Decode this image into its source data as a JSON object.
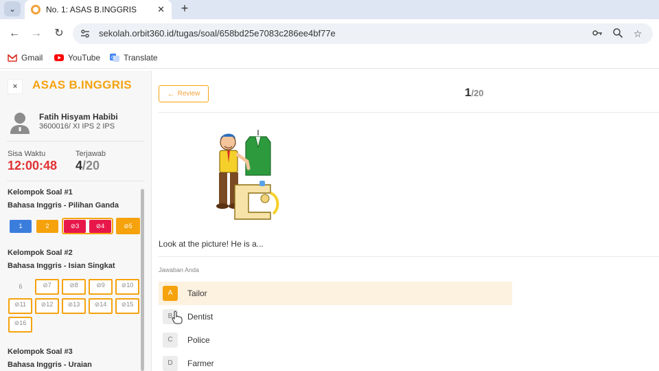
{
  "browser": {
    "tab_title": "No. 1: ASAS B.INGGRIS",
    "new_tab": "+",
    "url": "sekolah.orbit360.id/tugas/soal/658bd25e7083c286ee4bf77e",
    "bookmarks": [
      "Gmail",
      "YouTube",
      "Translate"
    ]
  },
  "sidebar": {
    "close": "×",
    "subject": "ASAS B.INGGRIS",
    "user_name": "Fatih Hisyam Habibi",
    "user_id": "3600016/ XI IPS 2 IPS",
    "time_label": "Sisa Waktu",
    "time_value": "12:00:48",
    "answered_label": "Terjawab",
    "answered_value": "4",
    "answered_total": "/20",
    "groups": [
      {
        "title": "Kelompok Soal #1",
        "subtitle": "Bahasa Inggris - Pilihan Ganda",
        "questions": [
          "1",
          "2",
          "3",
          "4",
          "5"
        ]
      },
      {
        "title": "Kelompok Soal #2",
        "subtitle": "Bahasa Inggris - Isian Singkat",
        "questions": [
          "6",
          "7",
          "8",
          "9",
          "10",
          "11",
          "12",
          "13",
          "14",
          "15",
          "16"
        ]
      },
      {
        "title": "Kelompok Soal #3",
        "subtitle": "Bahasa Inggris - Uraian"
      }
    ]
  },
  "main": {
    "review_label": "Review",
    "current": "1",
    "total": "/20",
    "question": "Look at the picture! He is a...",
    "answer_label": "Jawaban Anda",
    "options": [
      {
        "letter": "A",
        "text": "Tailor",
        "selected": true
      },
      {
        "letter": "B",
        "text": "Dentist",
        "selected": false
      },
      {
        "letter": "C",
        "text": "Police",
        "selected": false
      },
      {
        "letter": "D",
        "text": "Farmer",
        "selected": false
      }
    ]
  },
  "colors": {
    "accent": "#f5a20d",
    "timer": "#e03131",
    "flagged": "#e8174a",
    "current": "#3b7ddd"
  }
}
